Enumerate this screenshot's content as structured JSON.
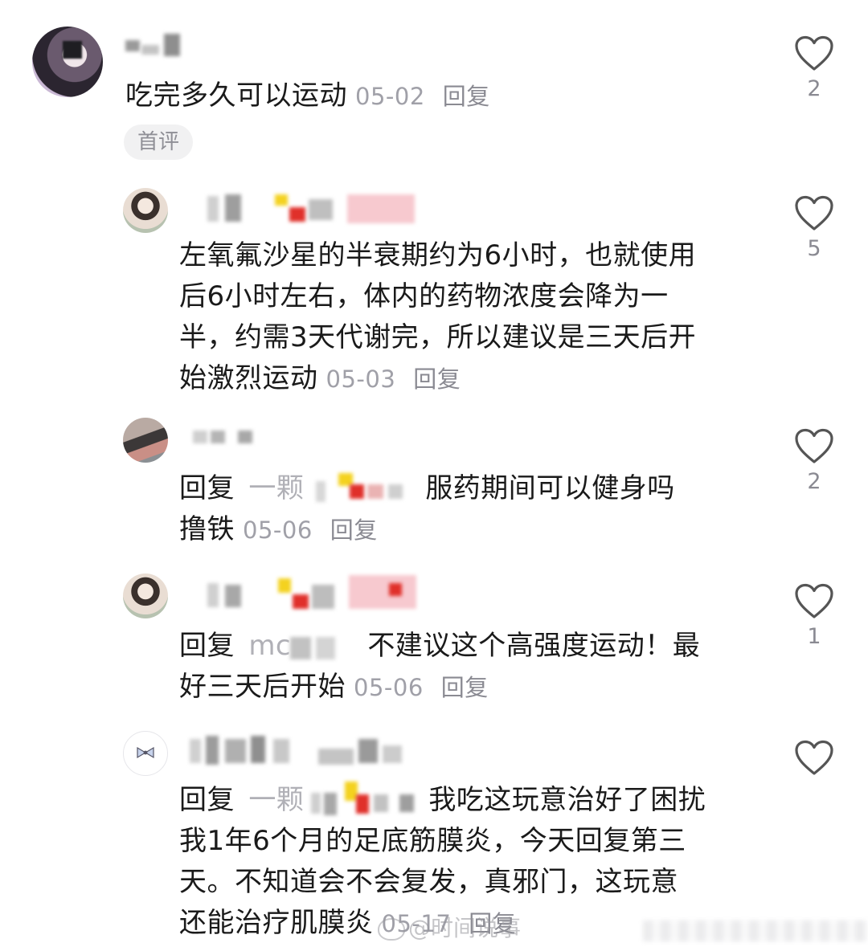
{
  "comments": [
    {
      "text": "吃完多久可以运动",
      "date": "05-02",
      "reply": "回复",
      "badge": "首评",
      "likes": "2"
    },
    {
      "lines": [
        "左氧氟沙星的半衰期约为6小时，也就使用",
        "后6小时左右，体内的药物浓度会降为一",
        "半，约需3天代谢完，所以建议是三天后开",
        "始激烈运动"
      ],
      "date": "05-03",
      "reply": "回复",
      "likes": "5"
    },
    {
      "prefix": "回复",
      "target": "一颗",
      "line1": "服药期间可以健身吗",
      "line2": "撸铁",
      "date": "05-06",
      "reply": "回复",
      "likes": "2"
    },
    {
      "prefix": "回复",
      "target": "mc",
      "line1": "不建议这个高强度运动！最",
      "line2": "好三天后开始",
      "date": "05-06",
      "reply": "回复",
      "likes": "1"
    },
    {
      "prefix": "回复",
      "target": "一颗",
      "line1": "我吃这玩意治好了困扰",
      "lines": [
        "我1年6个月的足底筋膜炎，今天回复第三",
        "天。不知道会不会复发，真邪门，这玩意",
        "还能治疗肌膜炎"
      ],
      "date": "05-17",
      "reply": "回复",
      "likes": ""
    }
  ],
  "watermark": "@时间说事",
  "colors": {
    "text": "#1a1a1a",
    "meta": "#a0a0a8",
    "heart": "#555555"
  }
}
